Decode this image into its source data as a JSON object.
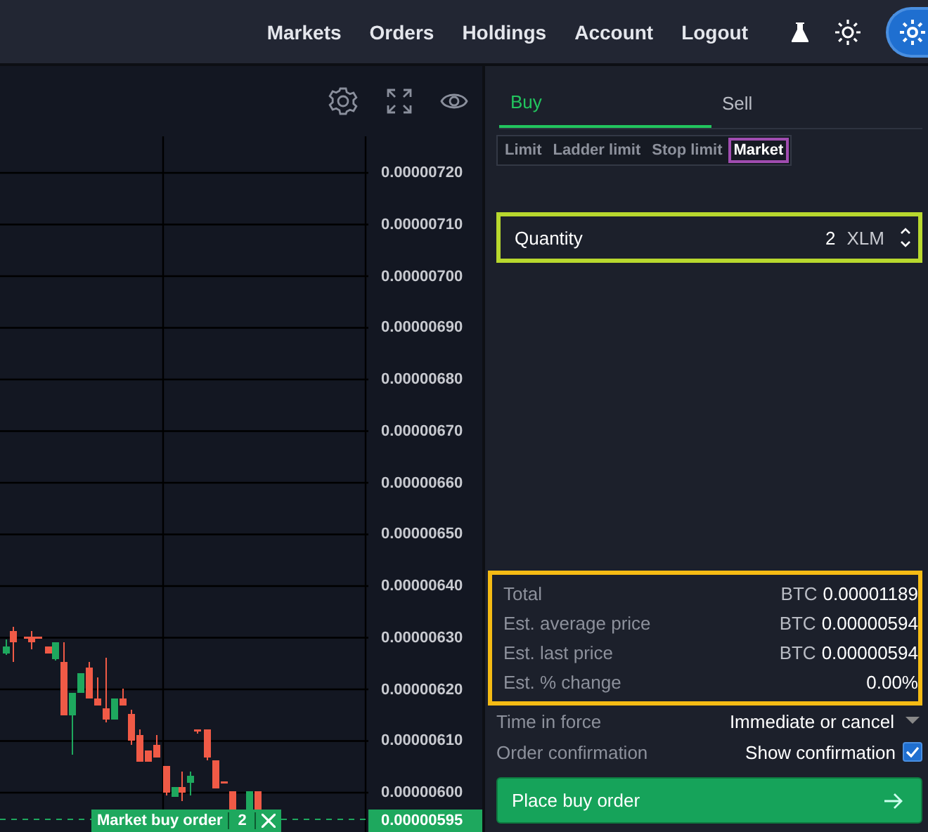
{
  "nav": [
    "Markets",
    "Orders",
    "Holdings",
    "Account",
    "Logout"
  ],
  "chart": {
    "price_labels": [
      "0.00000720",
      "0.00000710",
      "0.00000700",
      "0.00000690",
      "0.00000680",
      "0.00000670",
      "0.00000660",
      "0.00000650",
      "0.00000640",
      "0.00000630",
      "0.00000620",
      "0.00000610",
      "0.00000600"
    ],
    "current_price": "0.00000595",
    "order_tag": {
      "label": "Market buy order",
      "quantity": "2"
    }
  },
  "tabs": [
    {
      "label": "Buy",
      "selected": true
    },
    {
      "label": "Sell",
      "selected": false
    }
  ],
  "order_types": [
    {
      "label": "Limit",
      "selected": false
    },
    {
      "label": "Ladder limit",
      "selected": false
    },
    {
      "label": "Stop limit",
      "selected": false
    },
    {
      "label": "Market",
      "selected": true
    }
  ],
  "quantity": {
    "label": "Quantity",
    "value": "2",
    "unit": "XLM"
  },
  "summary": [
    {
      "label": "Total",
      "currency": "BTC",
      "value": "0.00001189"
    },
    {
      "label": "Est. average price",
      "currency": "BTC",
      "value": "0.00000594"
    },
    {
      "label": "Est. last price",
      "currency": "BTC",
      "value": "0.00000594"
    },
    {
      "label": "Est. % change",
      "value": "0.00%"
    }
  ],
  "time_in_force": {
    "label": "Time in force",
    "value": "Immediate or cancel"
  },
  "order_confirmation": {
    "label": "Order confirmation",
    "value": "Show confirmation",
    "checked": true
  },
  "submit": "Place buy order"
}
